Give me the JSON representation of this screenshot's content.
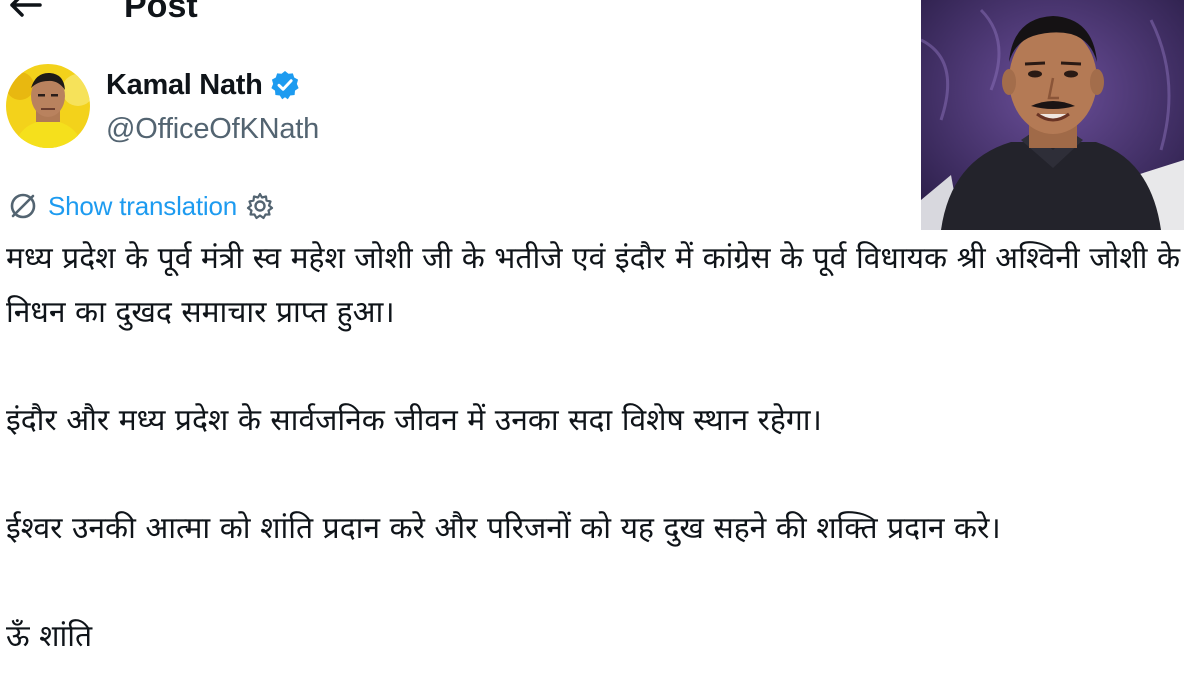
{
  "header": {
    "title": "Post",
    "back_icon": "arrow-left-icon"
  },
  "author": {
    "name": "Kamal Nath",
    "handle": "@OfficeOfKNath",
    "verified_icon": "verified-badge-icon",
    "verified_color": "#1d9bf0"
  },
  "translation": {
    "icon": "translate-icon",
    "label": "Show translation",
    "settings_icon": "gear-icon",
    "link_color": "#1d9bf0"
  },
  "post": {
    "paragraphs": [
      "मध्य प्रदेश के पूर्व मंत्री स्व महेश जोशी जी के भतीजे एवं इंदौर में कांग्रेस के पूर्व विधायक श्री अश्विनी जोशी के निधन का दुखद समाचार प्राप्त हुआ।",
      "इंदौर और मध्य प्रदेश के सार्वजनिक जीवन में उनका सदा विशेष स्थान रहेगा।",
      "ईश्वर उनकी आत्मा को शांति प्रदान करे और परिजनों को यह दुख सहने की शक्ति प्रदान करे।",
      "ऊँ शांति"
    ]
  },
  "colors": {
    "text": "#0f1419",
    "secondary": "#536471",
    "accent": "#1d9bf0"
  }
}
